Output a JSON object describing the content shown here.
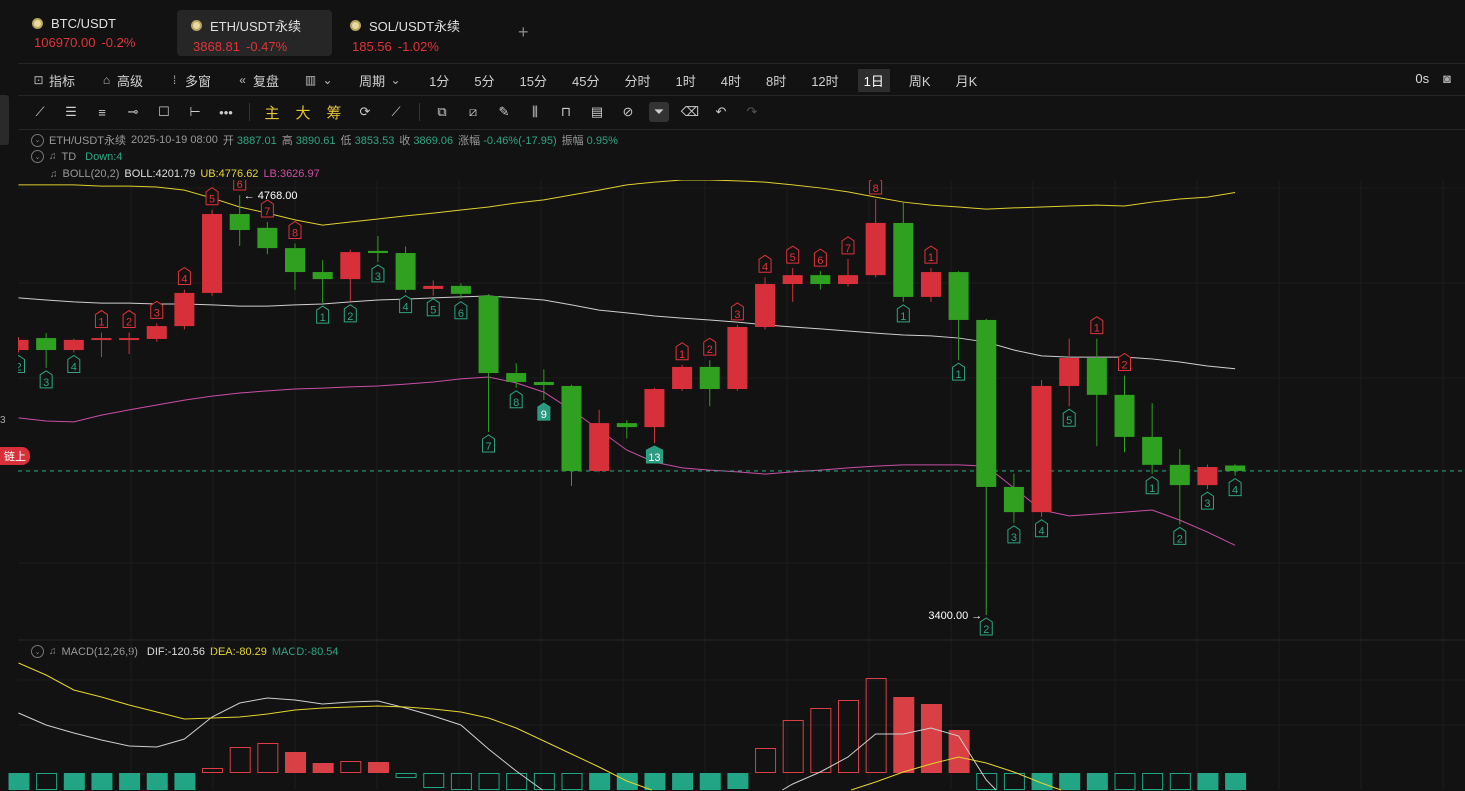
{
  "tabs": [
    {
      "symbol": "BTC/USDT",
      "price": "106970.00",
      "change": "-0.2%"
    },
    {
      "symbol": "ETH/USDT永续",
      "price": "3868.81",
      "change": "-0.47%",
      "active": true
    },
    {
      "symbol": "SOL/USDT永续",
      "price": "185.56",
      "change": "-1.02%"
    }
  ],
  "add_tab": "+",
  "toolbar": {
    "indicators": "指标",
    "advanced": "高级",
    "multi_window": "多窗",
    "replay": "复盘",
    "period": "周期",
    "periods": [
      "1分",
      "5分",
      "15分",
      "45分",
      "分时",
      "1时",
      "4时",
      "8时",
      "12时",
      "1日",
      "周K",
      "月K"
    ],
    "active_period": "1日",
    "countdown": "0s"
  },
  "draw_tools": {
    "main": "主",
    "big": "大",
    "chips": "筹"
  },
  "side": {
    "pill": "链上",
    "num": "3"
  },
  "info": {
    "symbol": "ETH/USDT永续",
    "date": "2025-10-19 08:00",
    "open_label": "开",
    "open": "3887.01",
    "high_label": "高",
    "high": "3890.61",
    "low_label": "低",
    "low": "3853.53",
    "close_label": "收",
    "close": "3869.06",
    "chg_label": "涨幅",
    "chg": "-0.46%(-17.95)",
    "amp_label": "振幅",
    "amp": "0.95%"
  },
  "td": {
    "name": "TD",
    "value": "Down:4"
  },
  "boll": {
    "name": "BOLL(20,2)",
    "mid": "BOLL:4201.79",
    "ub": "UB:4776.62",
    "lb": "LB:3626.97"
  },
  "macd": {
    "name": "MACD(12,26,9)",
    "dif": "DIF:-120.56",
    "dea": "DEA:-80.29",
    "macd": "MACD:-80.54"
  },
  "colors": {
    "up": "#d8303a",
    "down": "#2fa01f",
    "ub": "#e0d030",
    "lb": "#c94fa8",
    "mid": "#cfcfcf",
    "td_up": "#e0333b",
    "td_down": "#2ea582",
    "hist_pos": "#d84045",
    "hist_neg": "#22a584"
  },
  "chart_data": {
    "type": "candlestick",
    "max_label": "4768.00",
    "min_label": "3400.00",
    "last_price": 3869,
    "ohlc": [
      [
        4263,
        4305,
        4255,
        4296
      ],
      [
        4302,
        4318,
        4205,
        4263
      ],
      [
        4263,
        4300,
        4255,
        4296
      ],
      [
        4296,
        4320,
        4240,
        4302
      ],
      [
        4296,
        4320,
        4250,
        4302
      ],
      [
        4299,
        4350,
        4290,
        4341
      ],
      [
        4341,
        4460,
        4330,
        4449
      ],
      [
        4449,
        4720,
        4440,
        4706
      ],
      [
        4706,
        4768,
        4602,
        4654
      ],
      [
        4661,
        4680,
        4575,
        4595
      ],
      [
        4595,
        4610,
        4459,
        4517
      ],
      [
        4517,
        4556,
        4416,
        4494
      ],
      [
        4494,
        4590,
        4420,
        4582
      ],
      [
        4586,
        4634,
        4550,
        4579
      ],
      [
        4579,
        4600,
        4450,
        4459
      ],
      [
        4462,
        4490,
        4440,
        4472
      ],
      [
        4472,
        4480,
        4430,
        4446
      ],
      [
        4439,
        4445,
        3996,
        4188
      ],
      [
        4188,
        4220,
        4140,
        4159
      ],
      [
        4159,
        4200,
        4100,
        4149
      ],
      [
        4146,
        4150,
        3820,
        3869
      ],
      [
        3869,
        4068,
        3865,
        4025
      ],
      [
        4025,
        4035,
        3975,
        4012
      ],
      [
        4012,
        4140,
        3960,
        4136
      ],
      [
        4136,
        4215,
        4130,
        4208
      ],
      [
        4208,
        4230,
        4080,
        4136
      ],
      [
        4136,
        4345,
        4130,
        4338
      ],
      [
        4338,
        4500,
        4330,
        4478
      ],
      [
        4478,
        4530,
        4420,
        4507
      ],
      [
        4507,
        4520,
        4460,
        4478
      ],
      [
        4478,
        4560,
        4470,
        4507
      ],
      [
        4507,
        4755,
        4500,
        4677
      ],
      [
        4677,
        4745,
        4420,
        4436
      ],
      [
        4436,
        4530,
        4420,
        4517
      ],
      [
        4517,
        4520,
        4230,
        4361
      ],
      [
        4361,
        4365,
        3400,
        3817
      ],
      [
        3817,
        3860,
        3700,
        3735
      ],
      [
        3735,
        4165,
        3720,
        4146
      ],
      [
        4146,
        4300,
        4080,
        4237
      ],
      [
        4237,
        4300,
        3950,
        4117
      ],
      [
        4117,
        4180,
        3930,
        3980
      ],
      [
        3980,
        4090,
        3860,
        3889
      ],
      [
        3889,
        3940,
        3695,
        3823
      ],
      [
        3823,
        3890,
        3810,
        3882
      ],
      [
        3887,
        3891,
        3854,
        3869
      ]
    ],
    "td": [
      [
        "2",
        "b"
      ],
      [
        "3",
        "b"
      ],
      [
        "4",
        "b"
      ],
      [
        "1",
        "a"
      ],
      [
        "2",
        "a"
      ],
      [
        "3",
        "a"
      ],
      [
        "4",
        "a"
      ],
      [
        "5",
        "a"
      ],
      [
        "6",
        "a"
      ],
      [
        "7",
        "a"
      ],
      [
        "8",
        "a"
      ],
      [
        "1",
        "b"
      ],
      [
        "2",
        "b"
      ],
      [
        "3",
        "b"
      ],
      [
        "4",
        "b"
      ],
      [
        "5",
        "b"
      ],
      [
        "6",
        "b"
      ],
      [
        "7",
        "b"
      ],
      [
        "8",
        "b"
      ],
      [
        "9",
        "bf"
      ],
      null,
      null,
      null,
      [
        "13",
        "bf"
      ],
      [
        "1",
        "a"
      ],
      [
        "2",
        "a"
      ],
      [
        "3",
        "a"
      ],
      [
        "4",
        "a"
      ],
      [
        "5",
        "a"
      ],
      [
        "6",
        "a"
      ],
      [
        "7",
        "a"
      ],
      [
        "8",
        "a"
      ],
      [
        "1",
        "b"
      ],
      [
        "1",
        "a"
      ],
      [
        "1",
        "b"
      ],
      [
        "2",
        "b"
      ],
      [
        "3",
        "b"
      ],
      [
        "4",
        "b"
      ],
      [
        "5",
        "b"
      ],
      [
        "1",
        "a"
      ],
      [
        "2",
        "a"
      ],
      [
        "1",
        "b"
      ],
      [
        "2",
        "b"
      ],
      [
        "3",
        "b"
      ],
      [
        "4",
        "b"
      ]
    ],
    "boll_ub": [
      4801,
      4801,
      4801,
      4797,
      4797,
      4794,
      4784,
      4758,
      4729,
      4709,
      4687,
      4670,
      4680,
      4690,
      4700,
      4709,
      4719,
      4729,
      4742,
      4752,
      4768,
      4784,
      4801,
      4810,
      4817,
      4817,
      4814,
      4810,
      4801,
      4791,
      4778,
      4761,
      4745,
      4735,
      4729,
      4722,
      4726,
      4729,
      4732,
      4735,
      4732,
      4745,
      4755,
      4761,
      4776
    ],
    "boll_mid": [
      4433,
      4426,
      4420,
      4416,
      4416,
      4413,
      4413,
      4410,
      4406,
      4406,
      4410,
      4413,
      4420,
      4426,
      4429,
      4433,
      4436,
      4439,
      4433,
      4426,
      4410,
      4393,
      4384,
      4374,
      4367,
      4361,
      4354,
      4345,
      4338,
      4332,
      4325,
      4318,
      4312,
      4309,
      4302,
      4289,
      4263,
      4244,
      4240,
      4240,
      4240,
      4234,
      4224,
      4211,
      4202
    ],
    "boll_lb": [
      4042,
      4032,
      4029,
      4051,
      4068,
      4084,
      4100,
      4113,
      4123,
      4130,
      4136,
      4139,
      4143,
      4146,
      4152,
      4159,
      4169,
      4175,
      4156,
      4126,
      4068,
      4003,
      3937,
      3898,
      3879,
      3872,
      3866,
      3859,
      3866,
      3872,
      3879,
      3885,
      3889,
      3889,
      3889,
      3885,
      3814,
      3742,
      3723,
      3729,
      3735,
      3742,
      3709,
      3670,
      3627
    ],
    "macd_hist": [
      -70,
      -65,
      -70,
      -75,
      -72,
      -70,
      -60,
      10,
      52,
      60,
      42,
      20,
      24,
      22,
      -10,
      -30,
      -45,
      -50,
      -55,
      -55,
      -52,
      -58,
      -65,
      -62,
      -60,
      -50,
      -32,
      50,
      106,
      130,
      146,
      190,
      152,
      138,
      86,
      -40,
      -60,
      -80,
      -90,
      -95,
      -90,
      -85,
      -82,
      -84,
      -80.54
    ],
    "macd_hollow": [
      0,
      1,
      0,
      0,
      0,
      0,
      0,
      1,
      1,
      1,
      0,
      0,
      1,
      0,
      1,
      1,
      1,
      1,
      1,
      1,
      1,
      0,
      0,
      0,
      0,
      0,
      0,
      1,
      1,
      1,
      1,
      1,
      0,
      0,
      0,
      1,
      1,
      0,
      0,
      0,
      1,
      1,
      1,
      0,
      0
    ],
    "dif": [
      120,
      96,
      80,
      66,
      54,
      52,
      68,
      112,
      140,
      150,
      146,
      138,
      142,
      144,
      130,
      114,
      96,
      48,
      4,
      -36,
      -70,
      -100,
      -120,
      -135,
      -140,
      -130,
      -100,
      -54,
      -22,
      2,
      32,
      78,
      78,
      90,
      74,
      -14,
      -70,
      -100,
      -115,
      -125,
      -130,
      -130,
      -128,
      -125,
      -120.56
    ],
    "dea": [
      220,
      196,
      166,
      152,
      136,
      122,
      108,
      110,
      112,
      118,
      126,
      130,
      132,
      134,
      132,
      128,
      122,
      110,
      90,
      64,
      38,
      12,
      -16,
      -36,
      -50,
      -60,
      -62,
      -60,
      -55,
      -46,
      -36,
      -18,
      2,
      18,
      32,
      20,
      2,
      -20,
      -40,
      -52,
      -62,
      -70,
      -75,
      -78,
      -80.29
    ]
  }
}
